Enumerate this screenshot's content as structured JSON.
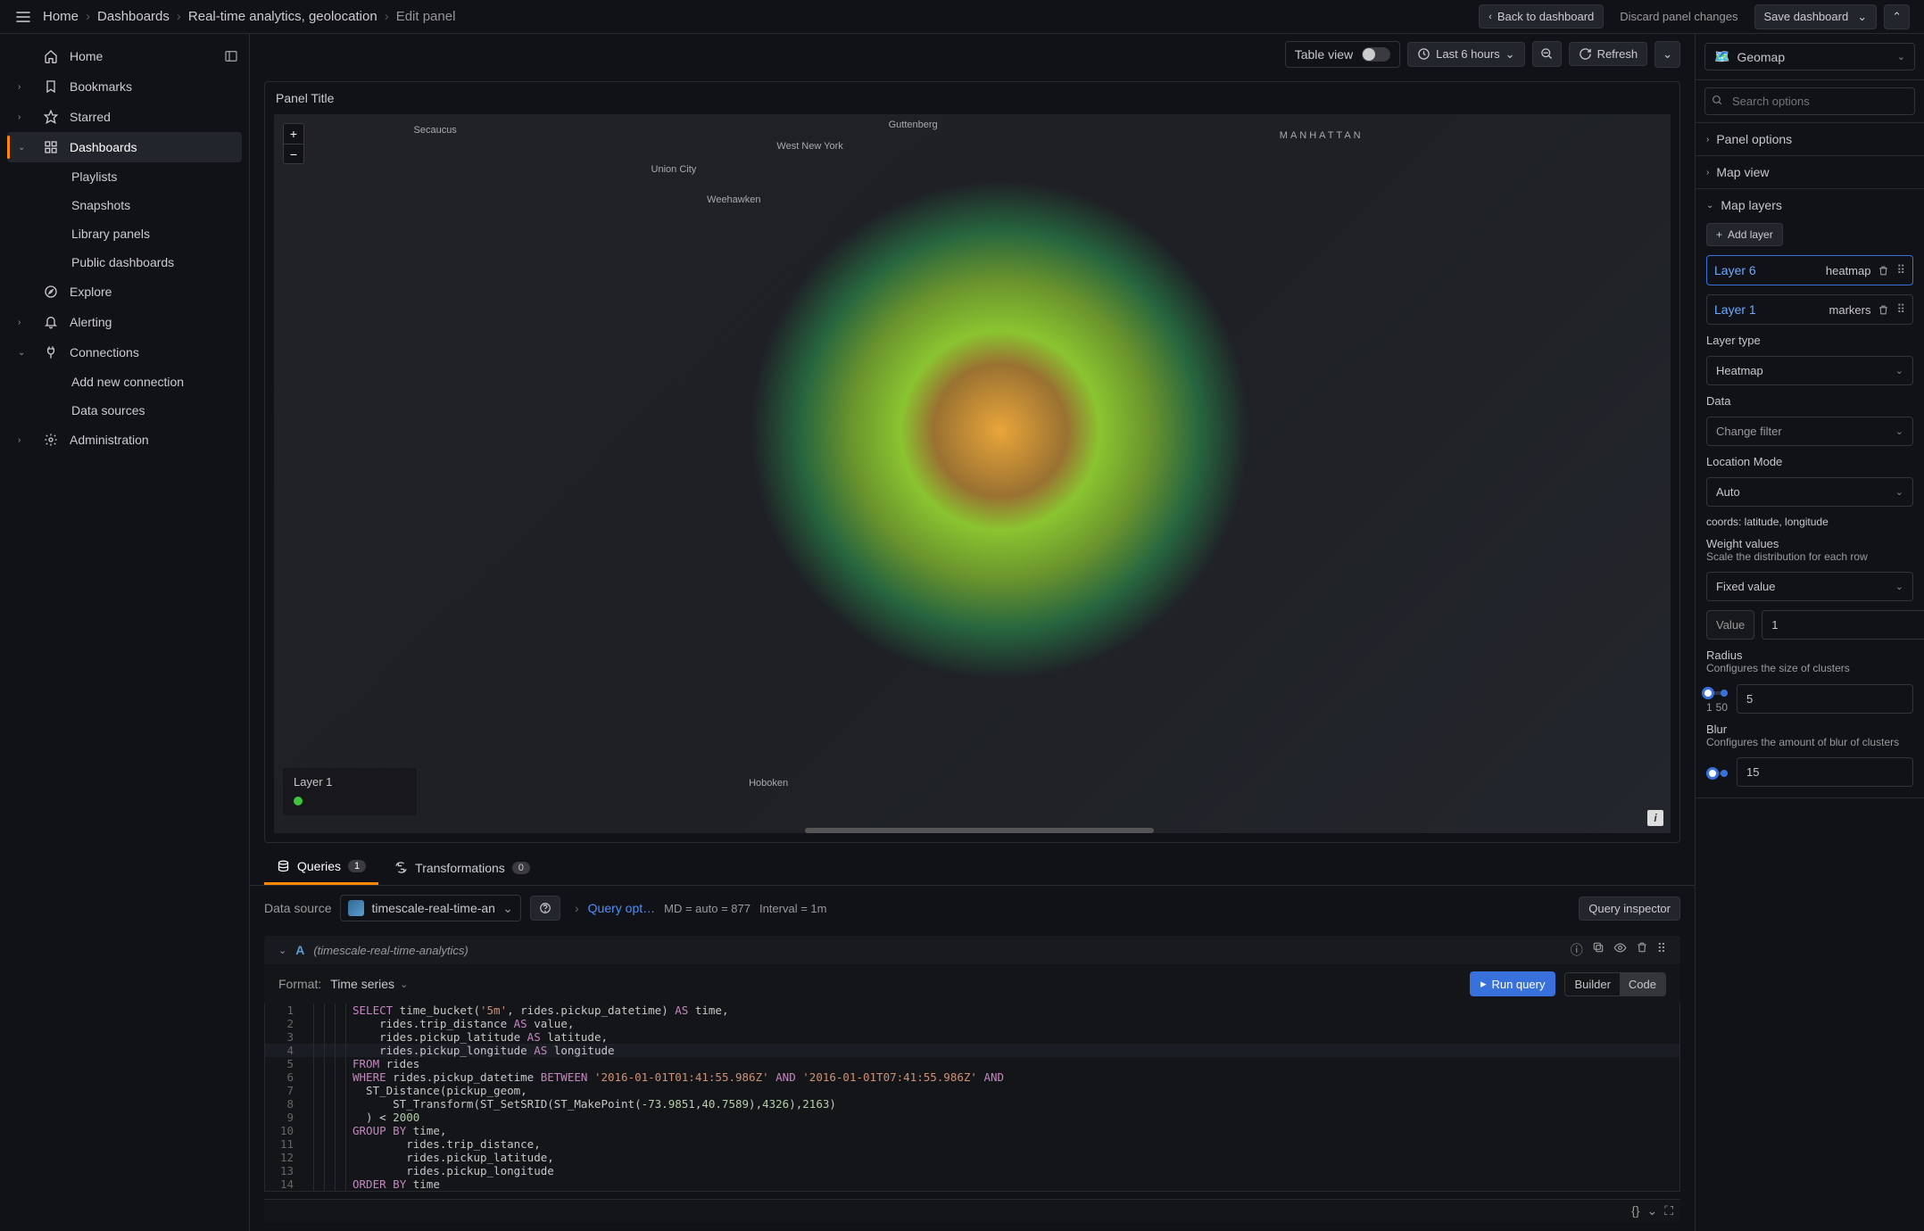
{
  "breadcrumbs": {
    "home": "Home",
    "dashboards": "Dashboards",
    "page": "Real-time analytics, geolocation",
    "active": "Edit panel"
  },
  "topbar": {
    "back": "Back to dashboard",
    "discard": "Discard panel changes",
    "save": "Save dashboard"
  },
  "sidebar": {
    "home": "Home",
    "bookmarks": "Bookmarks",
    "starred": "Starred",
    "dashboards": "Dashboards",
    "playlists": "Playlists",
    "snapshots": "Snapshots",
    "library": "Library panels",
    "public": "Public dashboards",
    "explore": "Explore",
    "alerting": "Alerting",
    "connections": "Connections",
    "addconn": "Add new connection",
    "datasources": "Data sources",
    "admin": "Administration"
  },
  "centerbar": {
    "tableview": "Table view",
    "timerange": "Last 6 hours",
    "refresh": "Refresh"
  },
  "panel": {
    "title": "Panel Title",
    "legendTitle": "Layer 1",
    "labels": {
      "guttenberg": "Guttenberg",
      "secaucus": "Secaucus",
      "westny": "West New York",
      "unioncity": "Union City",
      "manhattan": "MANHATTAN",
      "weehawken": "Weehawken",
      "hoboken": "Hoboken"
    }
  },
  "tabs": {
    "queries": "Queries",
    "qcount": "1",
    "transforms": "Transformations",
    "tcount": "0"
  },
  "querybar": {
    "dslabel": "Data source",
    "dsname": "timescale-real-time-an",
    "qopt": "Query opt…",
    "md": "MD = auto = 877",
    "interval": "Interval = 1m",
    "inspector": "Query inspector"
  },
  "queryhdr": {
    "letter": "A",
    "desc": "(timescale-real-time-analytics)"
  },
  "formatrow": {
    "format": "Format:",
    "formatval": "Time series",
    "run": "Run query",
    "builder": "Builder",
    "code": "Code"
  },
  "sql": [
    {
      "n": 1,
      "parts": [
        {
          "t": "SELECT",
          "c": "kw"
        },
        {
          "t": " time_bucket("
        },
        {
          "t": "'5m'",
          "c": "str"
        },
        {
          "t": ", rides.pickup_datetime) "
        },
        {
          "t": "AS",
          "c": "kw"
        },
        {
          "t": " time,"
        }
      ]
    },
    {
      "n": 2,
      "parts": [
        {
          "t": "    rides.trip_distance "
        },
        {
          "t": "AS",
          "c": "kw"
        },
        {
          "t": " value,"
        }
      ]
    },
    {
      "n": 3,
      "parts": [
        {
          "t": "    rides.pickup_latitude "
        },
        {
          "t": "AS",
          "c": "kw"
        },
        {
          "t": " latitude,"
        }
      ]
    },
    {
      "n": 4,
      "hl": true,
      "parts": [
        {
          "t": "    rides.pickup_longitude "
        },
        {
          "t": "AS",
          "c": "kw"
        },
        {
          "t": " longitude"
        }
      ]
    },
    {
      "n": 5,
      "parts": [
        {
          "t": "FROM",
          "c": "kw"
        },
        {
          "t": " rides"
        }
      ]
    },
    {
      "n": 6,
      "parts": [
        {
          "t": "WHERE",
          "c": "kw"
        },
        {
          "t": " rides.pickup_datetime "
        },
        {
          "t": "BETWEEN",
          "c": "kw"
        },
        {
          "t": " "
        },
        {
          "t": "'2016-01-01T01:41:55.986Z'",
          "c": "str"
        },
        {
          "t": " "
        },
        {
          "t": "AND",
          "c": "kw"
        },
        {
          "t": " "
        },
        {
          "t": "'2016-01-01T07:41:55.986Z'",
          "c": "str"
        },
        {
          "t": " "
        },
        {
          "t": "AND",
          "c": "kw"
        }
      ]
    },
    {
      "n": 7,
      "parts": [
        {
          "t": "  ST_Distance(pickup_geom,"
        }
      ]
    },
    {
      "n": 8,
      "parts": [
        {
          "t": "      ST_Transform(ST_SetSRID(ST_MakePoint("
        },
        {
          "t": "-73.9851",
          "c": "num-lit"
        },
        {
          "t": ","
        },
        {
          "t": "40.7589",
          "c": "num-lit"
        },
        {
          "t": "),"
        },
        {
          "t": "4326",
          "c": "num-lit"
        },
        {
          "t": "),"
        },
        {
          "t": "2163",
          "c": "num-lit"
        },
        {
          "t": ")"
        }
      ]
    },
    {
      "n": 9,
      "parts": [
        {
          "t": "  ) "
        },
        {
          "t": "<",
          "c": "op"
        },
        {
          "t": " "
        },
        {
          "t": "2000",
          "c": "num-lit"
        }
      ]
    },
    {
      "n": 10,
      "parts": [
        {
          "t": "GROUP",
          "c": "kw"
        },
        {
          "t": " "
        },
        {
          "t": "BY",
          "c": "kw"
        },
        {
          "t": " time,"
        }
      ]
    },
    {
      "n": 11,
      "parts": [
        {
          "t": "        rides.trip_distance,"
        }
      ]
    },
    {
      "n": 12,
      "parts": [
        {
          "t": "        rides.pickup_latitude,"
        }
      ]
    },
    {
      "n": 13,
      "parts": [
        {
          "t": "        rides.pickup_longitude"
        }
      ]
    },
    {
      "n": 14,
      "parts": [
        {
          "t": "ORDER",
          "c": "kw"
        },
        {
          "t": " "
        },
        {
          "t": "BY",
          "c": "kw"
        },
        {
          "t": " time"
        }
      ]
    }
  ],
  "right": {
    "viztype": "Geomap",
    "searchPlaceholder": "Search options",
    "groups": {
      "panelopts": "Panel options",
      "mapview": "Map view",
      "maplayers": "Map layers"
    },
    "addlayer": "Add layer",
    "layers": [
      {
        "name": "Layer 6",
        "type": "heatmap"
      },
      {
        "name": "Layer 1",
        "type": "markers"
      }
    ],
    "layertype_label": "Layer type",
    "layertype": "Heatmap",
    "data_label": "Data",
    "data_val": "Change filter",
    "loc_label": "Location Mode",
    "loc_val": "Auto",
    "coords": "coords: latitude, longitude",
    "weight_label": "Weight values",
    "weight_sub": "Scale the distribution for each row",
    "weight_val": "Fixed value",
    "value_label": "Value",
    "value_val": "1",
    "radius_label": "Radius",
    "radius_sub": "Configures the size of clusters",
    "radius_min": "1",
    "radius_max": "50",
    "radius_val": "5",
    "blur_label": "Blur",
    "blur_sub": "Configures the amount of blur of clusters",
    "blur_val": "15"
  }
}
